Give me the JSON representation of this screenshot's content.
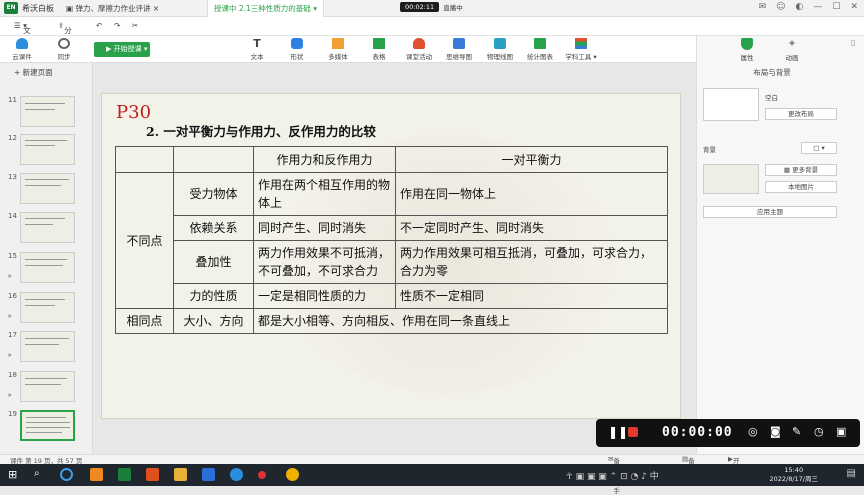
{
  "app": {
    "name": "希沃白板",
    "tabs": [
      "弹力、摩擦力作业评讲",
      "授课中 2.1三种性质力的基础"
    ],
    "live_time": "00:02:11",
    "live_label": "直播中",
    "window_controls": [
      "feedback",
      "user",
      "skin",
      "minimize",
      "maximize",
      "close"
    ]
  },
  "menu": {
    "file": "文件",
    "share": "分享"
  },
  "toolbar": {
    "cloud": "云课件",
    "sync": "同步",
    "start": "开始授课",
    "tools": [
      "文本",
      "形状",
      "多媒体",
      "表格",
      "课堂活动",
      "思维导图",
      "物理线图",
      "统计图表",
      "学科工具"
    ]
  },
  "left_panel": {
    "new_page": "新建页面",
    "pages": [
      "11",
      "12",
      "13",
      "14",
      "15",
      "16",
      "17",
      "18",
      "19"
    ],
    "active_page": "19"
  },
  "slide": {
    "page_label": "P30",
    "heading": "2. 一对平衡力与作用力、反作用力的比较",
    "table": {
      "col_headers": [
        "作用力和反作用力",
        "一对平衡力"
      ],
      "group_diff": "不同点",
      "group_same": "相同点",
      "rows": [
        {
          "label": "受力物体",
          "a": "作用在两个相互作用的物体上",
          "b": "作用在同一物体上"
        },
        {
          "label": "依赖关系",
          "a": "同时产生、同时消失",
          "b": "不一定同时产生、同时消失"
        },
        {
          "label": "叠加性",
          "a": "两力作用效果不可抵消，不可叠加，不可求合力",
          "b": "两力作用效果可相互抵消，可叠加，可求合力，合力为零"
        },
        {
          "label": "力的性质",
          "a": "一定是相同性质的力",
          "b": "性质不一定相同"
        }
      ],
      "same_label": "大小、方向",
      "same_value": "都是大小相等、方向相反、作用在同一条直线上"
    }
  },
  "right_panel": {
    "tabs": [
      "属性",
      "动画"
    ],
    "title": "布局与背景",
    "layout_label": "空白",
    "change_layout": "更改布局",
    "background_label": "背景",
    "more_bg": "更多背景",
    "local_image": "本地图片",
    "apply_theme": "应用主题"
  },
  "status": {
    "page_info": "课件 第 19 页，共 57 页",
    "helper": "备课助手",
    "notes": "备注",
    "start": "开始"
  },
  "recorder": {
    "time": "00:00:00"
  },
  "taskbar": {
    "time": "15:40",
    "date": "2022/8/17/周三"
  }
}
